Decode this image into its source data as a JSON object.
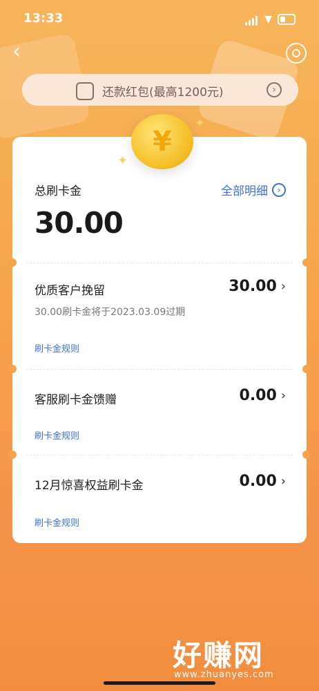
{
  "status": {
    "time": "13:33"
  },
  "banner": {
    "text": "还款红包(最高1200元)"
  },
  "summary": {
    "label": "总刷卡金",
    "amount": "30.00",
    "detail_link": "全部明细"
  },
  "items": [
    {
      "title": "优质客户挽留",
      "value": "30.00",
      "note": "30.00刷卡金将于2023.03.09过期",
      "rule": "刷卡金规则"
    },
    {
      "title": "客服刷卡金馈赠",
      "value": "0.00",
      "rule": "刷卡金规则"
    },
    {
      "title": "12月惊喜权益刷卡金",
      "value": "0.00",
      "rule": "刷卡金规则"
    }
  ],
  "watermark": {
    "title": "好赚网",
    "url": "www.zhuanyes.com"
  },
  "icons": {
    "back": "chevron-left-icon",
    "support": "customer-service-icon",
    "banner": "gift-envelope-icon",
    "coin": "yuan-coin-icon"
  }
}
